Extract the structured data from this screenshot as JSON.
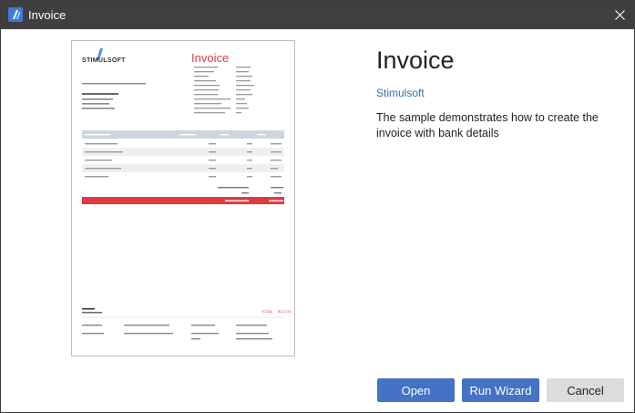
{
  "window": {
    "title": "Invoice",
    "app_icon": "stimulsoft-app-icon",
    "close_icon": "close-icon"
  },
  "info": {
    "title": "Invoice",
    "author": "Stimulsoft",
    "description": "The sample demonstrates how to create the invoice with bank details"
  },
  "buttons": {
    "open": "Open",
    "run_wizard": "Run Wizard",
    "cancel": "Cancel"
  },
  "preview": {
    "logo": "STIMULSOFT",
    "heading": "Invoice",
    "total_label": "TOTAL",
    "total_value": "$12,723"
  },
  "colors": {
    "titlebar": "#3f3f3f",
    "accent": "#4472c4",
    "invoice_red": "#e0393e",
    "table_header": "#cfd5dc"
  }
}
